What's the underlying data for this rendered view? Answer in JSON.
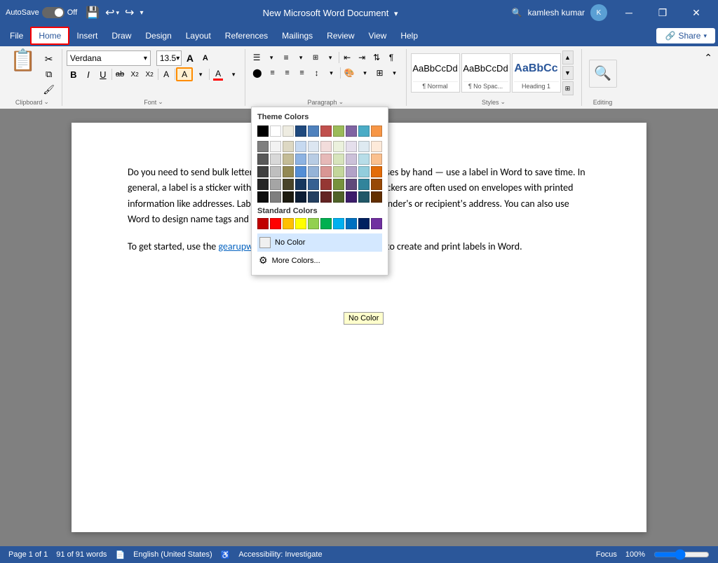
{
  "titlebar": {
    "autosave_label": "AutoSave",
    "autosave_state": "Off",
    "doc_title": "New Microsoft Word Document",
    "user_name": "kamlesh kumar",
    "save_icon": "💾",
    "undo_icon": "↩",
    "redo_icon": "↪",
    "more_icon": "⌄",
    "search_icon": "🔍",
    "minimize_icon": "─",
    "restore_icon": "❐",
    "close_icon": "✕"
  },
  "menubar": {
    "items": [
      "File",
      "Home",
      "Insert",
      "Draw",
      "Design",
      "Layout",
      "References",
      "Mailings",
      "Review",
      "View",
      "Help"
    ],
    "active": "Home",
    "share_label": "Share"
  },
  "ribbon": {
    "clipboard": {
      "paste_label": "Paste",
      "group_label": "Clipboard",
      "expander": "⌄"
    },
    "font": {
      "font_name": "Verdana",
      "font_size": "13.5",
      "bold": "B",
      "italic": "I",
      "underline": "U",
      "strikethrough": "ab",
      "subscript": "X₂",
      "superscript": "X²",
      "clear_format": "A",
      "group_label": "Font",
      "expander": "⌄",
      "grow": "A",
      "shrink": "A"
    },
    "paragraph": {
      "group_label": "Paragraph",
      "expander": "⌄"
    },
    "styles": {
      "group_label": "Styles",
      "expander": "⌄",
      "items": [
        {
          "label": "¶ Normal",
          "preview_text": "AaBbCcDd",
          "preview_style": "normal"
        },
        {
          "label": "¶ No Spac...",
          "preview_text": "AaBbCcDd",
          "preview_style": "nospace"
        },
        {
          "label": "Heading 1",
          "preview_text": "AaBbCc",
          "preview_style": "heading1"
        }
      ]
    },
    "editing": {
      "label": "Editing",
      "icon": "🔍"
    }
  },
  "color_picker": {
    "theme_title": "Theme Colors",
    "standard_title": "Standard Colors",
    "no_color_label": "No Color",
    "more_colors_label": "More Colors...",
    "tooltip": "No Color",
    "theme_row": [
      "#000000",
      "#ffffff",
      "#eeece1",
      "#1f497d",
      "#4f81bd",
      "#c0504d",
      "#9bbb59",
      "#8064a2",
      "#4bacc6",
      "#f79646"
    ],
    "theme_shades": [
      [
        "#7f7f7f",
        "#595959",
        "#3f3f3f",
        "#262626",
        "#0d0d0d"
      ],
      [
        "#f2f2f2",
        "#d8d8d8",
        "#bfbfbf",
        "#a5a5a5",
        "#7f7f7f"
      ],
      [
        "#ddd8c3",
        "#c4bc96",
        "#938953",
        "#494429",
        "#1d1b10"
      ],
      [
        "#c6d9f0",
        "#8db3e2",
        "#538ed5",
        "#17375e",
        "#0d1e35"
      ],
      [
        "#dce6f1",
        "#b8cce4",
        "#95b3d7",
        "#366092",
        "#243f60"
      ],
      [
        "#f2dcdb",
        "#e6b9b8",
        "#d99694",
        "#953734",
        "#632423"
      ],
      [
        "#ebf1dd",
        "#d7e4bc",
        "#c3d69b",
        "#76923c",
        "#4f6228"
      ],
      [
        "#e5dfec",
        "#ccc1d9",
        "#b2a2c7",
        "#60497a",
        "#3d1d6b"
      ],
      [
        "#deeaf1",
        "#b7dde8",
        "#92cddc",
        "#31849b",
        "#215868"
      ],
      [
        "#fdeada",
        "#fac08f",
        "#e36c09",
        "#974806",
        "#632f00"
      ]
    ],
    "standard_colors": [
      "#c00000",
      "#ff0000",
      "#ffc000",
      "#ffff00",
      "#92d050",
      "#00b050",
      "#00b0f0",
      "#0070c0",
      "#002060",
      "#7030a0"
    ]
  },
  "document": {
    "paragraph1": "Do you need to send bulk letters? You don't need to write addresses by hand — use a label in Word to save time. In general, a label is a sticker with something written on it. These stickers are often used on envelopes with printed information like addresses. Labels are mostly used to show the sender's or recipient's address. You can also use Word to design name tags and product labels.",
    "paragraph2_before": "To get started, use the ",
    "link_text": "gearupwindows",
    "paragraph2_after": " steps below to learn how to create and print labels in Word."
  },
  "statusbar": {
    "page_info": "Page 1 of 1",
    "word_count": "91 of 91 words",
    "language": "English (United States)",
    "accessibility": "Accessibility: Investigate",
    "focus": "Focus",
    "zoom": "100%"
  }
}
